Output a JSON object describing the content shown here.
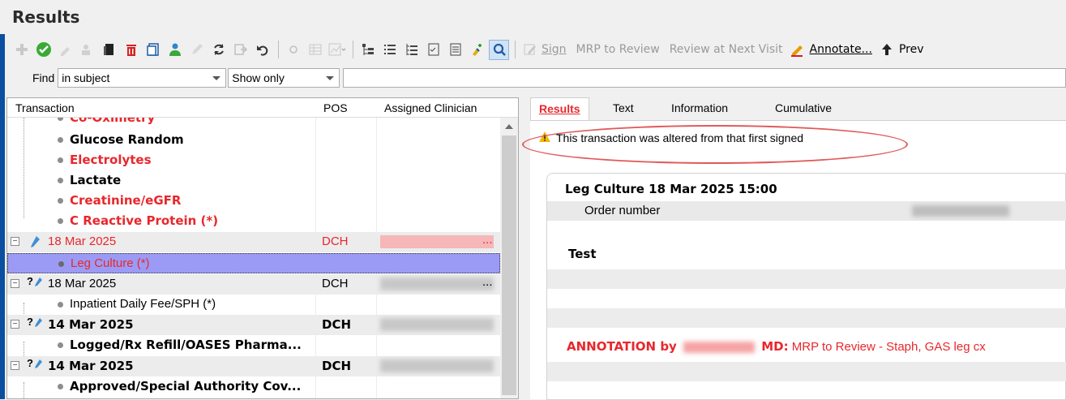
{
  "window": {
    "title": "Results"
  },
  "toolbar": {
    "sign_label": "Sign",
    "mrp_label": "MRP to Review",
    "review_label": "Review at Next Visit",
    "annotate_label": "Annotate...",
    "prev_label": "Prev"
  },
  "find": {
    "label": "Find",
    "scope_value": "in subject",
    "mode_value": "Show only",
    "query": ""
  },
  "tree": {
    "columns": [
      "Transaction",
      "POS",
      "Assigned Clinician"
    ],
    "rows": [
      {
        "label": "Co-Oximetry",
        "level": 1,
        "style": "red-bold",
        "pos": ""
      },
      {
        "label": "Glucose Random",
        "level": 1,
        "style": "bold",
        "pos": ""
      },
      {
        "label": "Electrolytes",
        "level": 1,
        "style": "red-bold",
        "pos": ""
      },
      {
        "label": "Lactate",
        "level": 1,
        "style": "bold",
        "pos": ""
      },
      {
        "label": "Creatinine/eGFR",
        "level": 1,
        "style": "red-bold",
        "pos": ""
      },
      {
        "label": "C Reactive Protein (*)",
        "level": 1,
        "style": "red-bold",
        "pos": ""
      },
      {
        "label": "18 Mar 2025",
        "level": 0,
        "style": "red",
        "pos": "DCH",
        "clinician": "..."
      },
      {
        "label": "Leg Culture (*)",
        "level": 1,
        "style": "red-selected",
        "pos": ""
      },
      {
        "label": "18 Mar 2025",
        "level": 0,
        "style": "normal",
        "pos": "DCH",
        "clinician": "..."
      },
      {
        "label": "Inpatient Daily Fee/SPH (*)",
        "level": 1,
        "style": "normal",
        "pos": ""
      },
      {
        "label": "14 Mar 2025",
        "level": 0,
        "style": "bold",
        "pos": "DCH"
      },
      {
        "label": "Logged/Rx Refill/OASES Pharma...",
        "level": 1,
        "style": "bold",
        "pos": ""
      },
      {
        "label": "14 Mar 2025",
        "level": 0,
        "style": "bold",
        "pos": "DCH"
      },
      {
        "label": "Approved/Special Authority Cov...",
        "level": 1,
        "style": "bold",
        "pos": ""
      }
    ]
  },
  "tabs": [
    "Results",
    "Text",
    "Information",
    "Cumulative"
  ],
  "result": {
    "warning": "This transaction was altered from that first signed",
    "title": "Leg Culture 18 Mar 2025 15:00",
    "order_label": "Order number",
    "test_header": "Test",
    "annotation_prefix": "ANNOTATION by",
    "annotation_suffix": "MD:",
    "annotation_text": "MRP to Review - Staph, GAS leg cx"
  },
  "colors": {
    "accent_red": "#e8272c",
    "selected_row": "#9b9bf5",
    "warning_ring": "#e05a5a"
  }
}
